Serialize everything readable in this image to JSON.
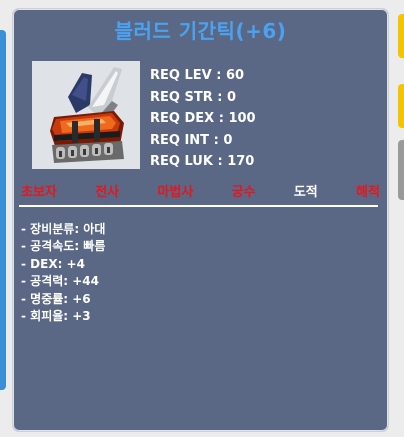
{
  "item": {
    "name": "블러드 기간틱(+6)",
    "title_color": "#4aa3f2",
    "icon": "bloody-gigantic-claw-icon"
  },
  "requirements": [
    {
      "label": "REQ LEV",
      "value": "60"
    },
    {
      "label": "REQ STR",
      "value": "0"
    },
    {
      "label": "REQ DEX",
      "value": "100"
    },
    {
      "label": "REQ INT",
      "value": "0"
    },
    {
      "label": "REQ LUK",
      "value": "170"
    }
  ],
  "jobs": [
    {
      "name": "초보자",
      "allowed": false
    },
    {
      "name": "전사",
      "allowed": false
    },
    {
      "name": "마법사",
      "allowed": false
    },
    {
      "name": "궁수",
      "allowed": false
    },
    {
      "name": "도적",
      "allowed": true
    },
    {
      "name": "해적",
      "allowed": false
    }
  ],
  "stats": [
    "- 장비분류: 아대",
    "- 공격속도: 빠름",
    "- DEX: +4",
    "- 공격력: +44",
    "- 명중률: +6",
    "- 회피율: +3"
  ],
  "colors": {
    "panel": "#5a6785",
    "disallowed_job": "#e8151b",
    "allowed_job": "#ffffff"
  }
}
